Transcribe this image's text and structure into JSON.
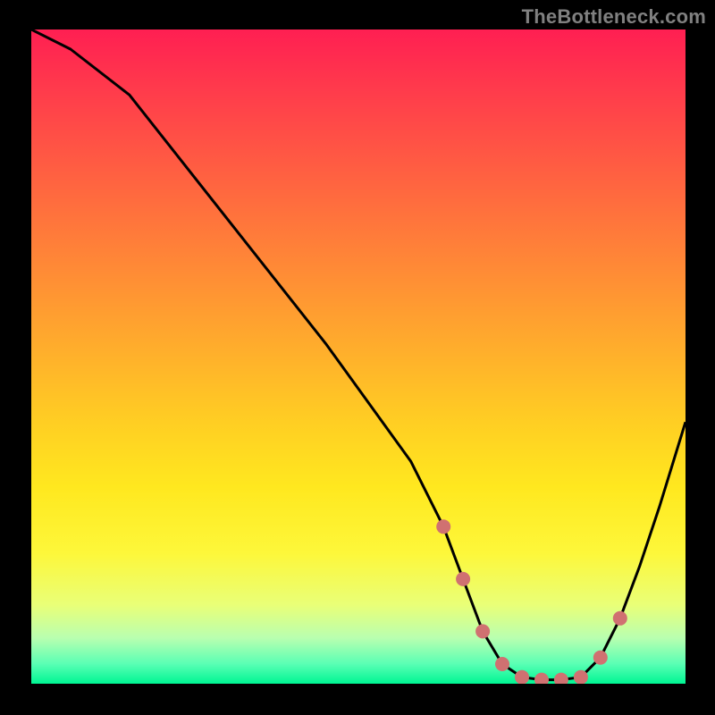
{
  "attribution": "TheBottleneck.com",
  "chart_data": {
    "type": "line",
    "title": "",
    "xlabel": "",
    "ylabel": "",
    "xlim": [
      0,
      100
    ],
    "ylim": [
      0,
      100
    ],
    "series": [
      {
        "name": "curve",
        "x": [
          0,
          6,
          15,
          30,
          45,
          58,
          63,
          66,
          69,
          72,
          75,
          78,
          81,
          84,
          87,
          90,
          93,
          96,
          100
        ],
        "values": [
          100,
          97,
          90,
          71,
          52,
          34,
          24,
          16,
          8,
          3,
          1,
          0.6,
          0.6,
          1,
          4,
          10,
          18,
          27,
          40
        ]
      }
    ],
    "markers": {
      "name": "dots",
      "color": "#d07171",
      "x": [
        63,
        66,
        69,
        72,
        75,
        78,
        81,
        84,
        87,
        90
      ],
      "values": [
        24,
        16,
        8,
        3,
        1,
        0.6,
        0.6,
        1,
        4,
        10
      ]
    }
  }
}
